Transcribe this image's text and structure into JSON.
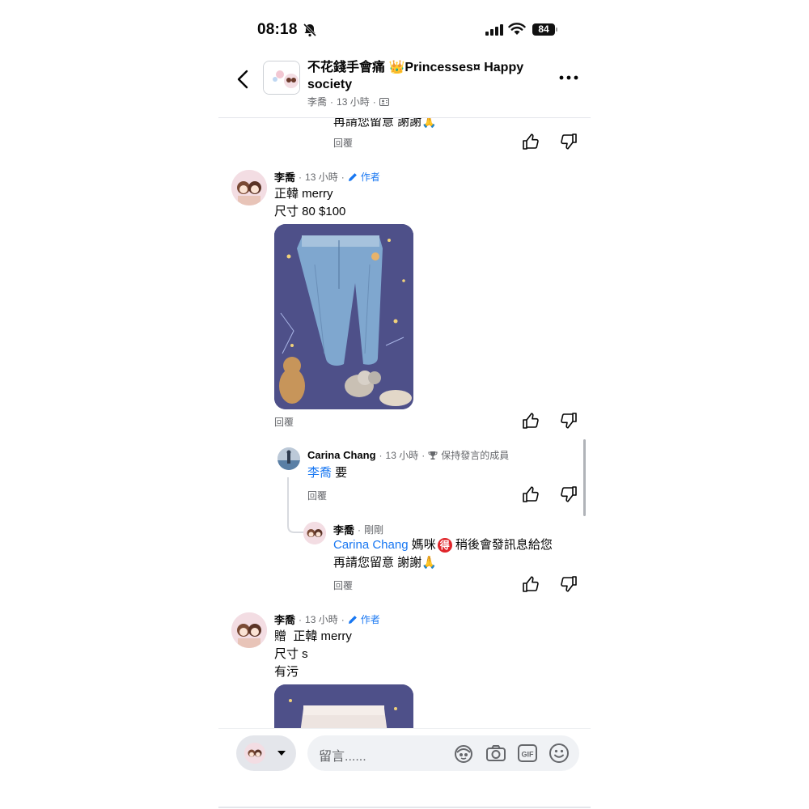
{
  "status_bar": {
    "time": "08:18",
    "battery": "84"
  },
  "header": {
    "group_name": "不花錢手會痛 👑Princesses¤ Happy society",
    "author": "李喬",
    "separator": "·",
    "time": "13 小時"
  },
  "comments": [
    {
      "partial_text": "再請您留意 謝謝🙏",
      "reply_label": "回覆"
    },
    {
      "name": "李喬",
      "time": "13 小時",
      "separator": "·",
      "badge": "作者",
      "lines": [
        "正韓 merry",
        "尺寸 80 $100"
      ],
      "reply_label": "回覆",
      "replies": [
        {
          "name": "Carina Chang",
          "time": "13 小時",
          "separator": "·",
          "badge": "保持發言的成員",
          "mention": "李喬",
          "text": " 要",
          "reply_label": "回覆"
        },
        {
          "name": "李喬",
          "time": "剛剛",
          "separator": "·",
          "mention": "Carina Chang",
          "text_a": " 媽咪",
          "emoji": "得",
          "text_b": " 稍後會發訊息給您",
          "line2": "再請您留意 謝謝🙏",
          "reply_label": "回覆"
        }
      ]
    },
    {
      "name": "李喬",
      "time": "13 小時",
      "separator": "·",
      "badge": "作者",
      "lines": [
        "贈  正韓 merry",
        "尺寸 s",
        "有污"
      ]
    }
  ],
  "composer": {
    "placeholder": "留言......"
  },
  "colors": {
    "link": "#1877f2",
    "meta": "#65676b",
    "background": "#ffffff",
    "input": "#f0f2f5"
  },
  "icons": [
    "bell-slash-icon",
    "signal-icon",
    "wifi-icon",
    "back-icon",
    "more-icon",
    "group-icon",
    "pencil-icon",
    "trophy-icon",
    "like-icon",
    "dislike-icon",
    "caret-down-icon",
    "avatar-sticker-icon",
    "camera-icon",
    "gif-icon",
    "emoji-icon"
  ]
}
